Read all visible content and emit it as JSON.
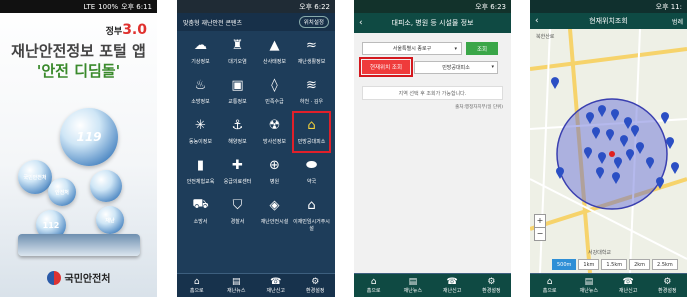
{
  "screen1": {
    "status": {
      "carrier": "LTE",
      "battery": "100%",
      "time": "오후 6:11"
    },
    "badge_prefix": "정부",
    "badge_num": "3.0",
    "title_line1": "재난안전정보 포털 앱",
    "title_line2": "'안전 디딤돌'",
    "drop_labels": [
      "119",
      "국민안전처",
      "안전처",
      "112",
      "재난"
    ],
    "logo_text": "국민안전처"
  },
  "screen2": {
    "status": {
      "time": "오후 6:22"
    },
    "header_title": "맞춤형 재난안전 콘텐츠",
    "header_button": "위치설정",
    "grid_items": [
      {
        "label": "기상정보",
        "icon": "cloud-icon"
      },
      {
        "label": "대기오염",
        "icon": "factory-icon"
      },
      {
        "label": "산사태정보",
        "icon": "mountain-icon"
      },
      {
        "label": "재난생활정보",
        "icon": "wave-icon"
      },
      {
        "label": "소방정보",
        "icon": "fire-icon"
      },
      {
        "label": "교통정보",
        "icon": "bus-icon"
      },
      {
        "label": "민족수급",
        "icon": "drop-icon"
      },
      {
        "label": "하천 · 김우",
        "icon": "river-icon"
      },
      {
        "label": "동농이정보",
        "icon": "snowflake-icon"
      },
      {
        "label": "해양정보",
        "icon": "ship-icon"
      },
      {
        "label": "방사선정보",
        "icon": "radiation-icon"
      },
      {
        "label": "민방공대피소",
        "icon": "shelter-icon"
      },
      {
        "label": "안전체험교육",
        "icon": "bars-icon"
      },
      {
        "label": "응급의료센터",
        "icon": "ambulance-icon"
      },
      {
        "label": "병원",
        "icon": "hospital-icon"
      },
      {
        "label": "약국",
        "icon": "pill-icon"
      },
      {
        "label": "소방서",
        "icon": "firetruck-icon"
      },
      {
        "label": "경찰서",
        "icon": "police-icon"
      },
      {
        "label": "재난안전시설",
        "icon": "shield-icon"
      },
      {
        "label": "이재민임시거주시설",
        "icon": "house-icon"
      }
    ],
    "highlight_index": 11,
    "nav": [
      {
        "label": "홈으로",
        "icon": "home-icon"
      },
      {
        "label": "재난뉴스",
        "icon": "news-icon"
      },
      {
        "label": "재난신고",
        "icon": "phone-icon"
      },
      {
        "label": "환경설정",
        "icon": "gear-icon"
      }
    ]
  },
  "screen3": {
    "status": {
      "time": "오후 6:23"
    },
    "header_title": "대피소, 병원 등 시설물 정보",
    "region_select": "서울특별시 종로구",
    "search_button": "조회",
    "current_location_button": "현재위치 조회",
    "facility_select": "민방공대피소",
    "notice": "지역 선택 후 조회가 가능합니다.",
    "source": "출처:행정자치부(일 단위)",
    "nav": [
      {
        "label": "홈으로",
        "icon": "home-icon"
      },
      {
        "label": "재난뉴스",
        "icon": "news-icon"
      },
      {
        "label": "재난신고",
        "icon": "phone-icon"
      },
      {
        "label": "환경설정",
        "icon": "gear-icon"
      }
    ]
  },
  "screen4": {
    "status": {
      "time": "오후 11:"
    },
    "header_title": "현재위치조회",
    "header_right": "범례",
    "map_labels": [
      "북한산로",
      "서강대학교"
    ],
    "distances": [
      "500m",
      "1km",
      "1.5km",
      "2km",
      "2.5km"
    ],
    "active_distance_index": 0,
    "nav": [
      {
        "label": "홈으로",
        "icon": "home-icon"
      },
      {
        "label": "재난뉴스",
        "icon": "news-icon"
      },
      {
        "label": "재난신고",
        "icon": "phone-icon"
      },
      {
        "label": "환경설정",
        "icon": "gear-icon"
      }
    ]
  }
}
